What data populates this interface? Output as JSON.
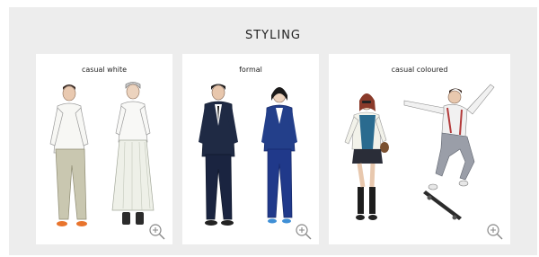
{
  "section": {
    "title": "STYLING"
  },
  "cards": [
    {
      "label": "casual white",
      "icon": "zoom-in-icon"
    },
    {
      "label": "formal",
      "icon": "zoom-in-icon"
    },
    {
      "label": "casual coloured",
      "icon": "zoom-in-icon"
    }
  ]
}
